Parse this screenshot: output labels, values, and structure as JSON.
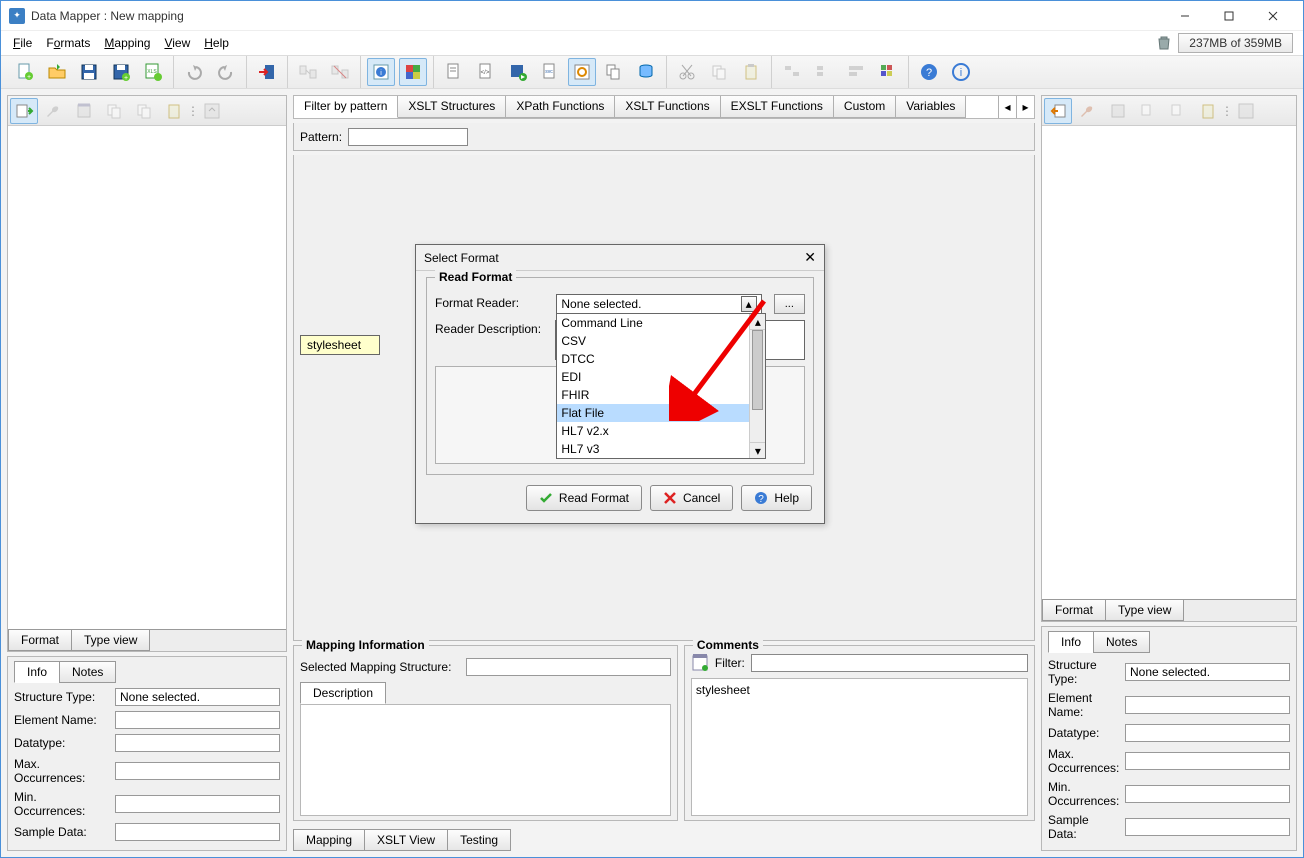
{
  "window": {
    "title": "Data Mapper : New mapping"
  },
  "menu": {
    "file": "File",
    "formats": "Formats",
    "mapping": "Mapping",
    "view": "View",
    "help": "Help"
  },
  "memory": {
    "label": "237MB of 359MB"
  },
  "center_tabs": [
    "Filter by pattern",
    "XSLT Structures",
    "XPath Functions",
    "XSLT Functions",
    "EXSLT Functions",
    "Custom",
    "Variables"
  ],
  "pattern_label": "Pattern:",
  "stylesheet_node": "stylesheet",
  "left_bottom_tabs": {
    "format": "Format",
    "typeview": "Type view"
  },
  "info_tabs": {
    "info": "Info",
    "notes": "Notes"
  },
  "info_fields": {
    "structure_type": "Structure Type:",
    "structure_type_value": "None selected.",
    "element_name": "Element Name:",
    "datatype": "Datatype:",
    "max_occ": "Max. Occurrences:",
    "min_occ": "Min. Occurrences:",
    "sample_data": "Sample Data:"
  },
  "mapping_info": {
    "legend": "Mapping Information",
    "selected_label": "Selected Mapping Structure:",
    "desc_tab": "Description"
  },
  "comments": {
    "legend": "Comments",
    "filter_label": "Filter:",
    "body": "stylesheet"
  },
  "map_tabs": {
    "mapping": "Mapping",
    "xslt": "XSLT View",
    "testing": "Testing"
  },
  "dialog": {
    "title": "Select Format",
    "fieldset_legend": "Read Format",
    "format_reader_label": "Format Reader:",
    "combo_text": "None selected.",
    "browse": "...",
    "reader_desc_label": "Reader Description:",
    "options": [
      "Command Line",
      "CSV",
      "DTCC",
      "EDI",
      "FHIR",
      "Flat File",
      "HL7 v2.x",
      "HL7 v3"
    ],
    "selected_option": "Flat File",
    "btn_read": "Read Format",
    "btn_cancel": "Cancel",
    "btn_help": "Help"
  }
}
